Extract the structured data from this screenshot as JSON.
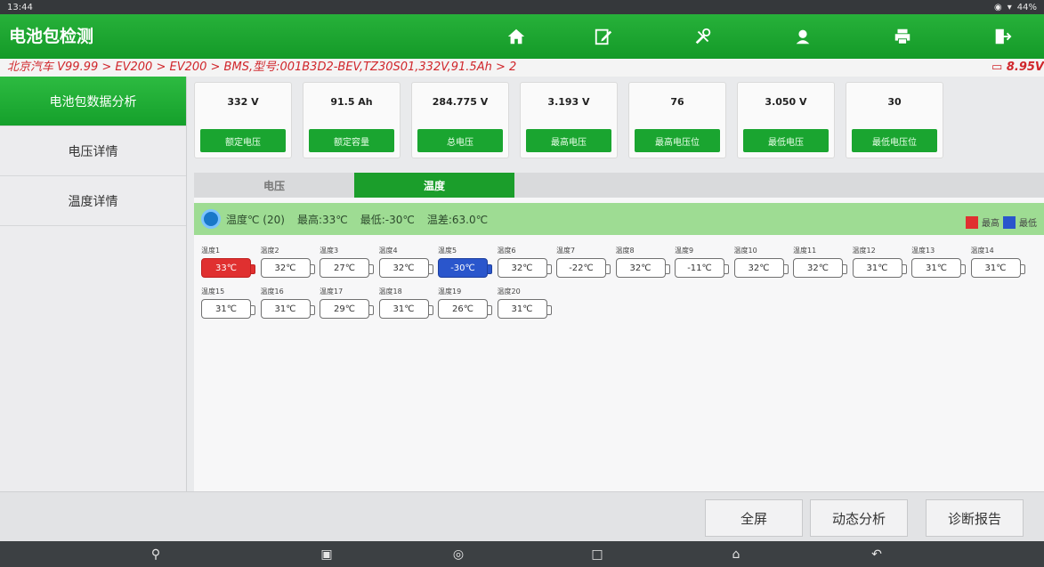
{
  "statusbar": {
    "time": "13:44",
    "battery": "44%"
  },
  "header": {
    "title": "电池包检测",
    "buttons": [
      "home-icon",
      "edit-icon",
      "tools-icon",
      "support-icon",
      "print-icon",
      "exit-icon"
    ]
  },
  "breadcrumb": {
    "path": "北京汽车 V99.99 > EV200 > EV200 > BMS,型号:001B3D2-BEV,TZ30S01,332V,91.5Ah > 2",
    "battery_voltage": "8.95V"
  },
  "sidebar": {
    "items": [
      {
        "label": "电池包数据分析",
        "active": true
      },
      {
        "label": "电压详情",
        "active": false
      },
      {
        "label": "温度详情",
        "active": false
      }
    ]
  },
  "cards": [
    {
      "value": "332 V",
      "label": "额定电压"
    },
    {
      "value": "91.5 Ah",
      "label": "额定容量"
    },
    {
      "value": "284.775 V",
      "label": "总电压"
    },
    {
      "value": "3.193 V",
      "label": "最高电压"
    },
    {
      "value": "76",
      "label": "最高电压位"
    },
    {
      "value": "3.050 V",
      "label": "最低电压"
    },
    {
      "value": "30",
      "label": "最低电压位"
    }
  ],
  "tabs": [
    {
      "label": "电压",
      "active": false
    },
    {
      "label": "温度",
      "active": true
    }
  ],
  "summary": {
    "count": "温度℃ (20)",
    "max": "最高:33℃",
    "min": "最低:-30℃",
    "diff": "温差:63.0℃"
  },
  "legend": {
    "high": "最高",
    "low": "最低",
    "high_color": "#e03030",
    "low_color": "#2a56cc"
  },
  "cells": [
    {
      "label": "温度1",
      "value": "33℃",
      "state": "hot"
    },
    {
      "label": "温度2",
      "value": "32℃",
      "state": "normal"
    },
    {
      "label": "温度3",
      "value": "27℃",
      "state": "normal"
    },
    {
      "label": "温度4",
      "value": "32℃",
      "state": "normal"
    },
    {
      "label": "温度5",
      "value": "-30℃",
      "state": "cold"
    },
    {
      "label": "温度6",
      "value": "32℃",
      "state": "normal"
    },
    {
      "label": "温度7",
      "value": "-22℃",
      "state": "normal"
    },
    {
      "label": "温度8",
      "value": "32℃",
      "state": "normal"
    },
    {
      "label": "温度9",
      "value": "-11℃",
      "state": "normal"
    },
    {
      "label": "温度10",
      "value": "32℃",
      "state": "normal"
    },
    {
      "label": "温度11",
      "value": "32℃",
      "state": "normal"
    },
    {
      "label": "温度12",
      "value": "31℃",
      "state": "normal"
    },
    {
      "label": "温度13",
      "value": "31℃",
      "state": "normal"
    },
    {
      "label": "温度14",
      "value": "31℃",
      "state": "normal"
    },
    {
      "label": "温度15",
      "value": "31℃",
      "state": "normal"
    },
    {
      "label": "温度16",
      "value": "31℃",
      "state": "normal"
    },
    {
      "label": "温度17",
      "value": "29℃",
      "state": "normal"
    },
    {
      "label": "温度18",
      "value": "31℃",
      "state": "normal"
    },
    {
      "label": "温度19",
      "value": "26℃",
      "state": "normal"
    },
    {
      "label": "温度20",
      "value": "31℃",
      "state": "normal"
    }
  ],
  "bottom_buttons": [
    "全屏",
    "动态分析",
    "诊断报告"
  ],
  "accent_color": "#1aa530"
}
